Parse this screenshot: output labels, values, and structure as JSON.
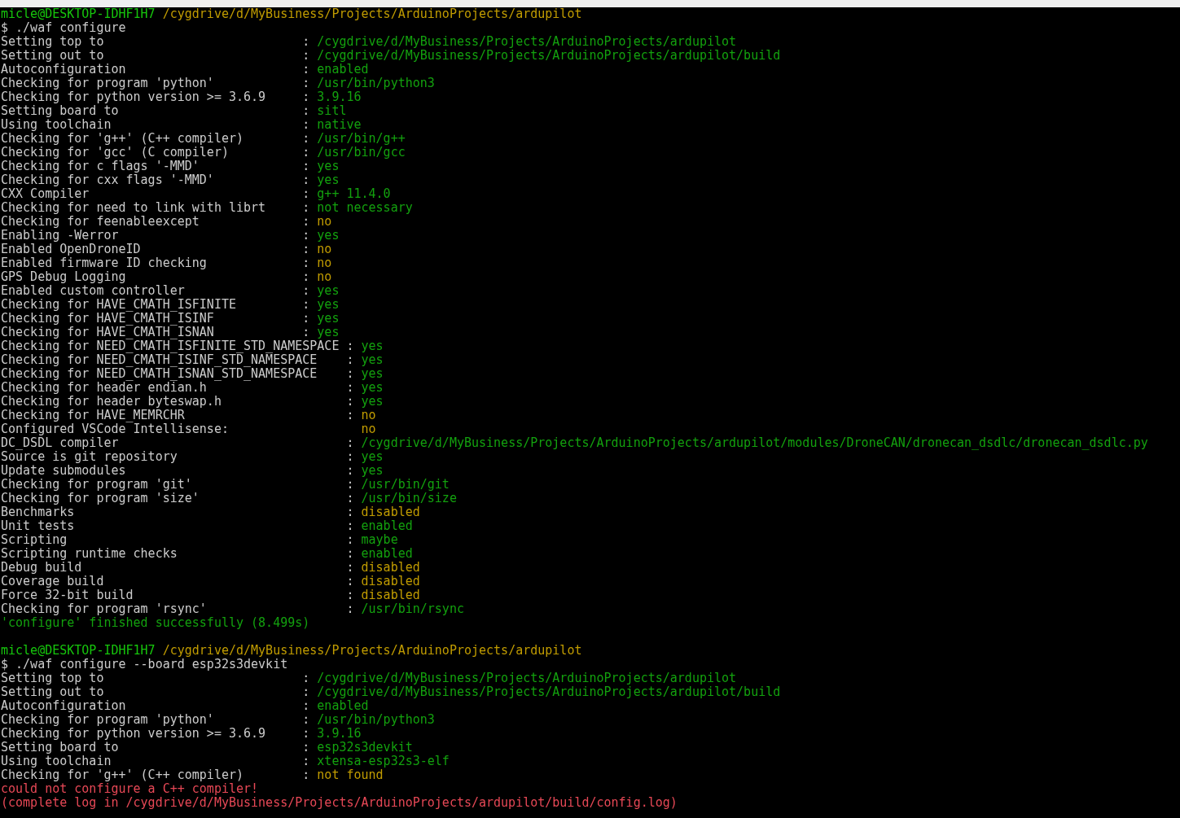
{
  "lines": [
    {
      "kind": "prompt",
      "user": "micle@DESKTOP-IDHF1H7",
      "path": "/cygdrive/d/MyBusiness/Projects/ArduinoProjects/ardupilot"
    },
    {
      "kind": "command",
      "text": "$ ./waf configure"
    },
    {
      "kind": "result",
      "label": "Setting top to                           : ",
      "value": "/cygdrive/d/MyBusiness/Projects/ArduinoProjects/ardupilot",
      "color": "#13a10e"
    },
    {
      "kind": "result",
      "label": "Setting out to                           : ",
      "value": "/cygdrive/d/MyBusiness/Projects/ArduinoProjects/ardupilot/build",
      "color": "#13a10e"
    },
    {
      "kind": "result",
      "label": "Autoconfiguration                        : ",
      "value": "enabled",
      "color": "#13a10e"
    },
    {
      "kind": "result",
      "label": "Checking for program 'python'            : ",
      "value": "/usr/bin/python3",
      "color": "#13a10e"
    },
    {
      "kind": "result",
      "label": "Checking for python version >= 3.6.9     : ",
      "value": "3.9.16",
      "color": "#13a10e"
    },
    {
      "kind": "result",
      "label": "Setting board to                         : ",
      "value": "sitl",
      "color": "#13a10e"
    },
    {
      "kind": "result",
      "label": "Using toolchain                          : ",
      "value": "native",
      "color": "#13a10e"
    },
    {
      "kind": "result",
      "label": "Checking for 'g++' (C++ compiler)        : ",
      "value": "/usr/bin/g++",
      "color": "#13a10e"
    },
    {
      "kind": "result",
      "label": "Checking for 'gcc' (C compiler)          : ",
      "value": "/usr/bin/gcc",
      "color": "#13a10e"
    },
    {
      "kind": "result",
      "label": "Checking for c flags '-MMD'              : ",
      "value": "yes",
      "color": "#13a10e"
    },
    {
      "kind": "result",
      "label": "Checking for cxx flags '-MMD'            : ",
      "value": "yes",
      "color": "#13a10e"
    },
    {
      "kind": "result",
      "label": "CXX Compiler                             : ",
      "value": "g++ 11.4.0",
      "color": "#13a10e"
    },
    {
      "kind": "result",
      "label": "Checking for need to link with librt     : ",
      "value": "not necessary",
      "color": "#13a10e"
    },
    {
      "kind": "result",
      "label": "Checking for feenableexcept              : ",
      "value": "no",
      "color": "#c19c00"
    },
    {
      "kind": "result",
      "label": "Enabling -Werror                         : ",
      "value": "yes",
      "color": "#13a10e"
    },
    {
      "kind": "result",
      "label": "Enabled OpenDroneID                      : ",
      "value": "no",
      "color": "#c19c00"
    },
    {
      "kind": "result",
      "label": "Enabled firmware ID checking             : ",
      "value": "no",
      "color": "#c19c00"
    },
    {
      "kind": "result",
      "label": "GPS Debug Logging                        : ",
      "value": "no",
      "color": "#c19c00"
    },
    {
      "kind": "result",
      "label": "Enabled custom controller                : ",
      "value": "yes",
      "color": "#13a10e"
    },
    {
      "kind": "result",
      "label": "Checking for HAVE_CMATH_ISFINITE         : ",
      "value": "yes",
      "color": "#13a10e"
    },
    {
      "kind": "result",
      "label": "Checking for HAVE_CMATH_ISINF            : ",
      "value": "yes",
      "color": "#13a10e"
    },
    {
      "kind": "result",
      "label": "Checking for HAVE_CMATH_ISNAN            : ",
      "value": "yes",
      "color": "#13a10e"
    },
    {
      "kind": "result",
      "label": "Checking for NEED_CMATH_ISFINITE_STD_NAMESPACE : ",
      "value": "yes",
      "color": "#13a10e"
    },
    {
      "kind": "result",
      "label": "Checking for NEED_CMATH_ISINF_STD_NAMESPACE    : ",
      "value": "yes",
      "color": "#13a10e"
    },
    {
      "kind": "result",
      "label": "Checking for NEED_CMATH_ISNAN_STD_NAMESPACE    : ",
      "value": "yes",
      "color": "#13a10e"
    },
    {
      "kind": "result",
      "label": "Checking for header endian.h                   : ",
      "value": "yes",
      "color": "#13a10e"
    },
    {
      "kind": "result",
      "label": "Checking for header byteswap.h                 : ",
      "value": "yes",
      "color": "#13a10e"
    },
    {
      "kind": "result",
      "label": "Checking for HAVE_MEMRCHR                      : ",
      "value": "no",
      "color": "#c19c00"
    },
    {
      "kind": "result",
      "label": "Configured VSCode Intellisense:                  ",
      "value": "no",
      "color": "#c19c00"
    },
    {
      "kind": "result",
      "label": "DC_DSDL compiler                               : ",
      "value": "/cygdrive/d/MyBusiness/Projects/ArduinoProjects/ardupilot/modules/DroneCAN/dronecan_dsdlc/dronecan_dsdlc.py",
      "color": "#13a10e"
    },
    {
      "kind": "result",
      "label": "Source is git repository                       : ",
      "value": "yes",
      "color": "#13a10e"
    },
    {
      "kind": "result",
      "label": "Update submodules                              : ",
      "value": "yes",
      "color": "#13a10e"
    },
    {
      "kind": "result",
      "label": "Checking for program 'git'                     : ",
      "value": "/usr/bin/git",
      "color": "#13a10e"
    },
    {
      "kind": "result",
      "label": "Checking for program 'size'                    : ",
      "value": "/usr/bin/size",
      "color": "#13a10e"
    },
    {
      "kind": "result",
      "label": "Benchmarks                                     : ",
      "value": "disabled",
      "color": "#c19c00"
    },
    {
      "kind": "result",
      "label": "Unit tests                                     : ",
      "value": "enabled",
      "color": "#13a10e"
    },
    {
      "kind": "result",
      "label": "Scripting                                      : ",
      "value": "maybe",
      "color": "#13a10e"
    },
    {
      "kind": "result",
      "label": "Scripting runtime checks                       : ",
      "value": "enabled",
      "color": "#13a10e"
    },
    {
      "kind": "result",
      "label": "Debug build                                    : ",
      "value": "disabled",
      "color": "#c19c00"
    },
    {
      "kind": "result",
      "label": "Coverage build                                 : ",
      "value": "disabled",
      "color": "#c19c00"
    },
    {
      "kind": "result",
      "label": "Force 32-bit build                             : ",
      "value": "disabled",
      "color": "#c19c00"
    },
    {
      "kind": "result",
      "label": "Checking for program 'rsync'                   : ",
      "value": "/usr/bin/rsync",
      "color": "#13a10e"
    },
    {
      "kind": "success",
      "text": "'configure' finished successfully (8.499s)"
    },
    {
      "kind": "blank"
    },
    {
      "kind": "prompt",
      "user": "micle@DESKTOP-IDHF1H7",
      "path": "/cygdrive/d/MyBusiness/Projects/ArduinoProjects/ardupilot"
    },
    {
      "kind": "command",
      "text": "$ ./waf configure --board esp32s3devkit"
    },
    {
      "kind": "result",
      "label": "Setting top to                           : ",
      "value": "/cygdrive/d/MyBusiness/Projects/ArduinoProjects/ardupilot",
      "color": "#13a10e"
    },
    {
      "kind": "result",
      "label": "Setting out to                           : ",
      "value": "/cygdrive/d/MyBusiness/Projects/ArduinoProjects/ardupilot/build",
      "color": "#13a10e"
    },
    {
      "kind": "result",
      "label": "Autoconfiguration                        : ",
      "value": "enabled",
      "color": "#13a10e"
    },
    {
      "kind": "result",
      "label": "Checking for program 'python'            : ",
      "value": "/usr/bin/python3",
      "color": "#13a10e"
    },
    {
      "kind": "result",
      "label": "Checking for python version >= 3.6.9     : ",
      "value": "3.9.16",
      "color": "#13a10e"
    },
    {
      "kind": "result",
      "label": "Setting board to                         : ",
      "value": "esp32s3devkit",
      "color": "#13a10e"
    },
    {
      "kind": "result",
      "label": "Using toolchain                          : ",
      "value": "xtensa-esp32s3-elf",
      "color": "#13a10e"
    },
    {
      "kind": "result",
      "label": "Checking for 'g++' (C++ compiler)        : ",
      "value": "not found",
      "color": "#c19c00"
    },
    {
      "kind": "error",
      "text": "could not configure a C++ compiler!"
    },
    {
      "kind": "error",
      "text": "(complete log in /cygdrive/d/MyBusiness/Projects/ArduinoProjects/ardupilot/build/config.log)"
    }
  ]
}
